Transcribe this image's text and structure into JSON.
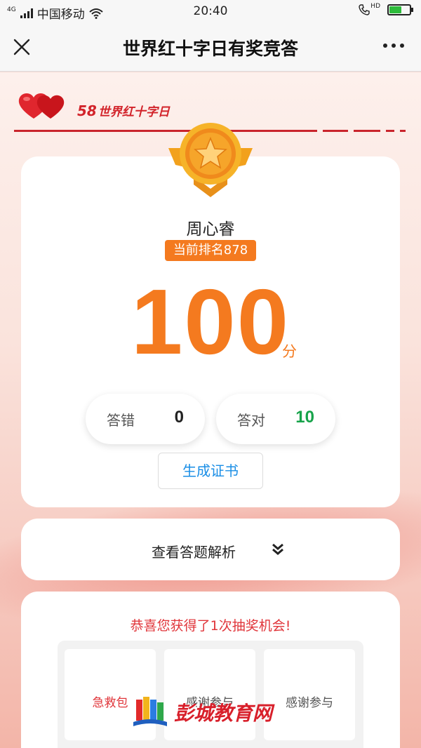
{
  "status_bar": {
    "network": "4G",
    "carrier": "中国移动",
    "time": "20:40",
    "hd": "HD",
    "battery_level": 0.6
  },
  "nav": {
    "title": "世界红十字日有奖竞答",
    "close_icon": "close-icon",
    "more_icon": "more-icon"
  },
  "banner": {
    "number": "58",
    "label": "世界红十字日",
    "accent": "#d2232a"
  },
  "result": {
    "user_name": "周心睿",
    "rank": "当前排名878",
    "score": "100",
    "score_unit": "分",
    "wrong_label": "答错",
    "wrong_count": "0",
    "right_label": "答对",
    "right_count": "10",
    "certificate_button": "生成证书"
  },
  "analysis": {
    "label": "查看答题解析",
    "icon": "double-chevron-down-icon"
  },
  "lottery": {
    "title": "恭喜您获得了1次抽奖机会!",
    "prizes": [
      "急救包",
      "感谢参与",
      "感谢参与"
    ]
  },
  "watermark": {
    "text": "彭城教育网"
  },
  "colors": {
    "score_orange": "#f47a1f",
    "right_green": "#17a34a",
    "link_blue": "#1a8ee6",
    "red": "#e0353a"
  }
}
